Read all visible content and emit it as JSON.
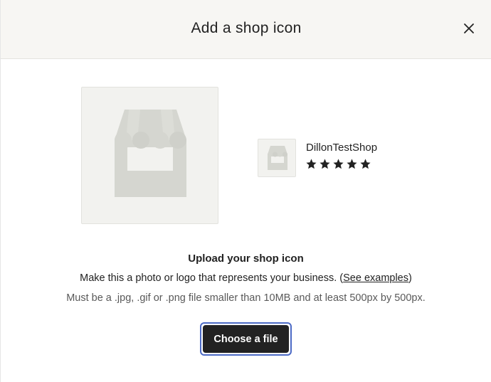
{
  "modal": {
    "title": "Add a shop icon",
    "close_icon": "close-icon",
    "preview": {
      "placeholder_icon": "storefront-icon",
      "shop_name": "DillonTestShop",
      "rating_stars": 5,
      "star_icon": "star-icon"
    },
    "upload": {
      "heading": "Upload your shop icon",
      "description": "Make this a photo or logo that represents your business. (",
      "examples_link": "See examples",
      "description_end": ")",
      "requirements": "Must be a .jpg, .gif or .png file smaller than 10MB and at least 500px by 500px.",
      "button_label": "Choose a file"
    },
    "colors": {
      "header_bg": "#f7f6f3",
      "placeholder_bg": "#f2f2ef",
      "placeholder_icon": "#d5d6d0",
      "button_bg": "#222222",
      "focus_ring": "#4d6bc6"
    }
  }
}
